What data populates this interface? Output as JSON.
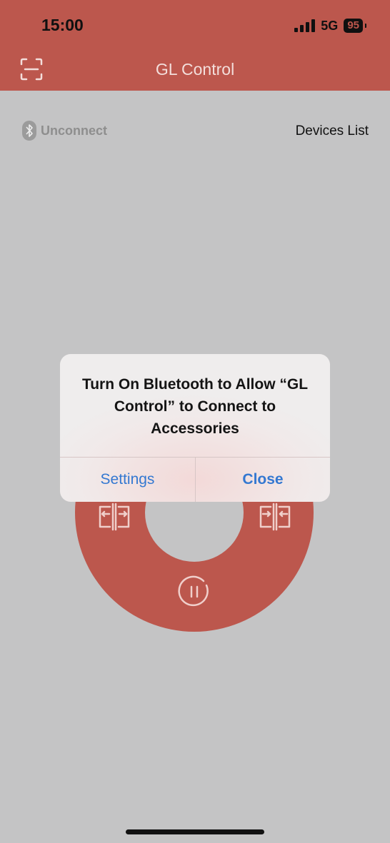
{
  "status_bar": {
    "time": "15:00",
    "network": "5G",
    "battery": "95"
  },
  "header": {
    "title": "GL Control"
  },
  "connection": {
    "status": "Unconnect",
    "devices_link": "Devices List"
  },
  "alert": {
    "message": "Turn On Bluetooth to Allow “GL Control” to Connect to Accessories",
    "settings_label": "Settings",
    "close_label": "Close"
  },
  "colors": {
    "accent": "#bc574d",
    "background": "#c4c4c5",
    "link": "#3478d1"
  }
}
